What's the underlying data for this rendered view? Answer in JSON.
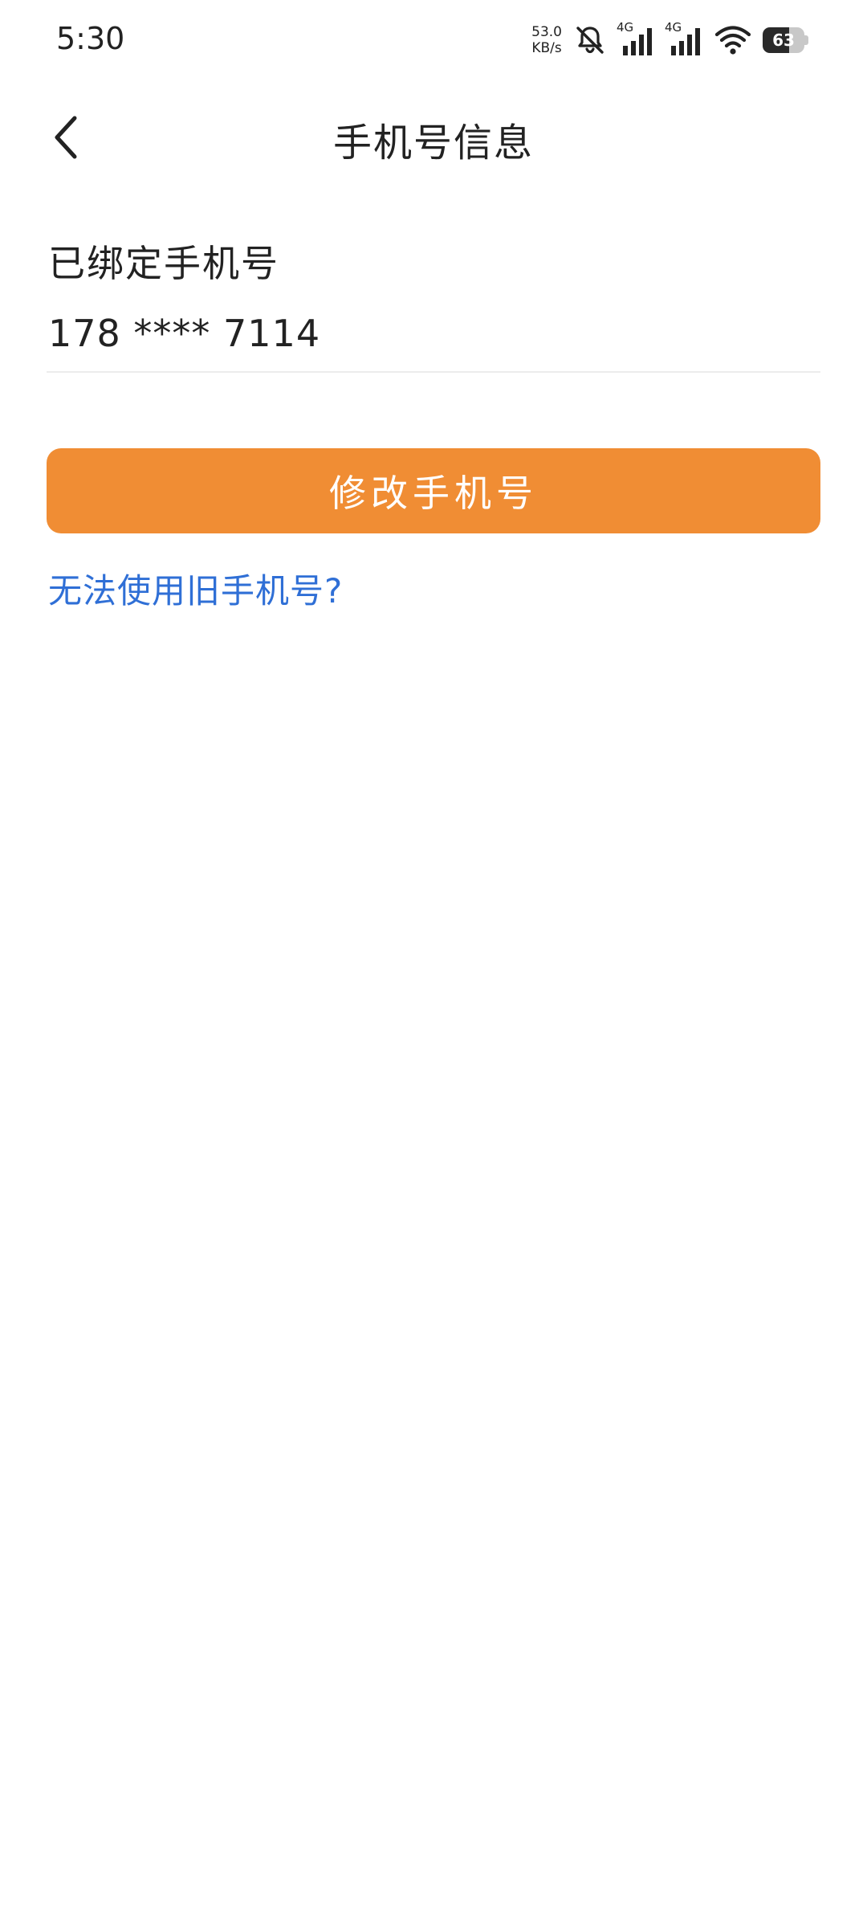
{
  "status_bar": {
    "time": "5:30",
    "net_speed_value": "53.0",
    "net_speed_unit": "KB/s",
    "sim1_label": "4G",
    "sim2_label": "4G",
    "battery_level": "63",
    "icons": [
      "mute-icon",
      "signal-icon",
      "signal-icon",
      "wifi-icon",
      "battery-icon"
    ]
  },
  "header": {
    "title": "手机号信息",
    "back_icon": "chevron-left-icon"
  },
  "content": {
    "bound_label": "已绑定手机号",
    "phone_value": "178 **** 7114",
    "change_button": "修改手机号",
    "help_link": "无法使用旧手机号?"
  },
  "colors": {
    "accent": "#f08d34",
    "link": "#2f6fd6",
    "text": "#222222",
    "divider": "#ececec"
  }
}
